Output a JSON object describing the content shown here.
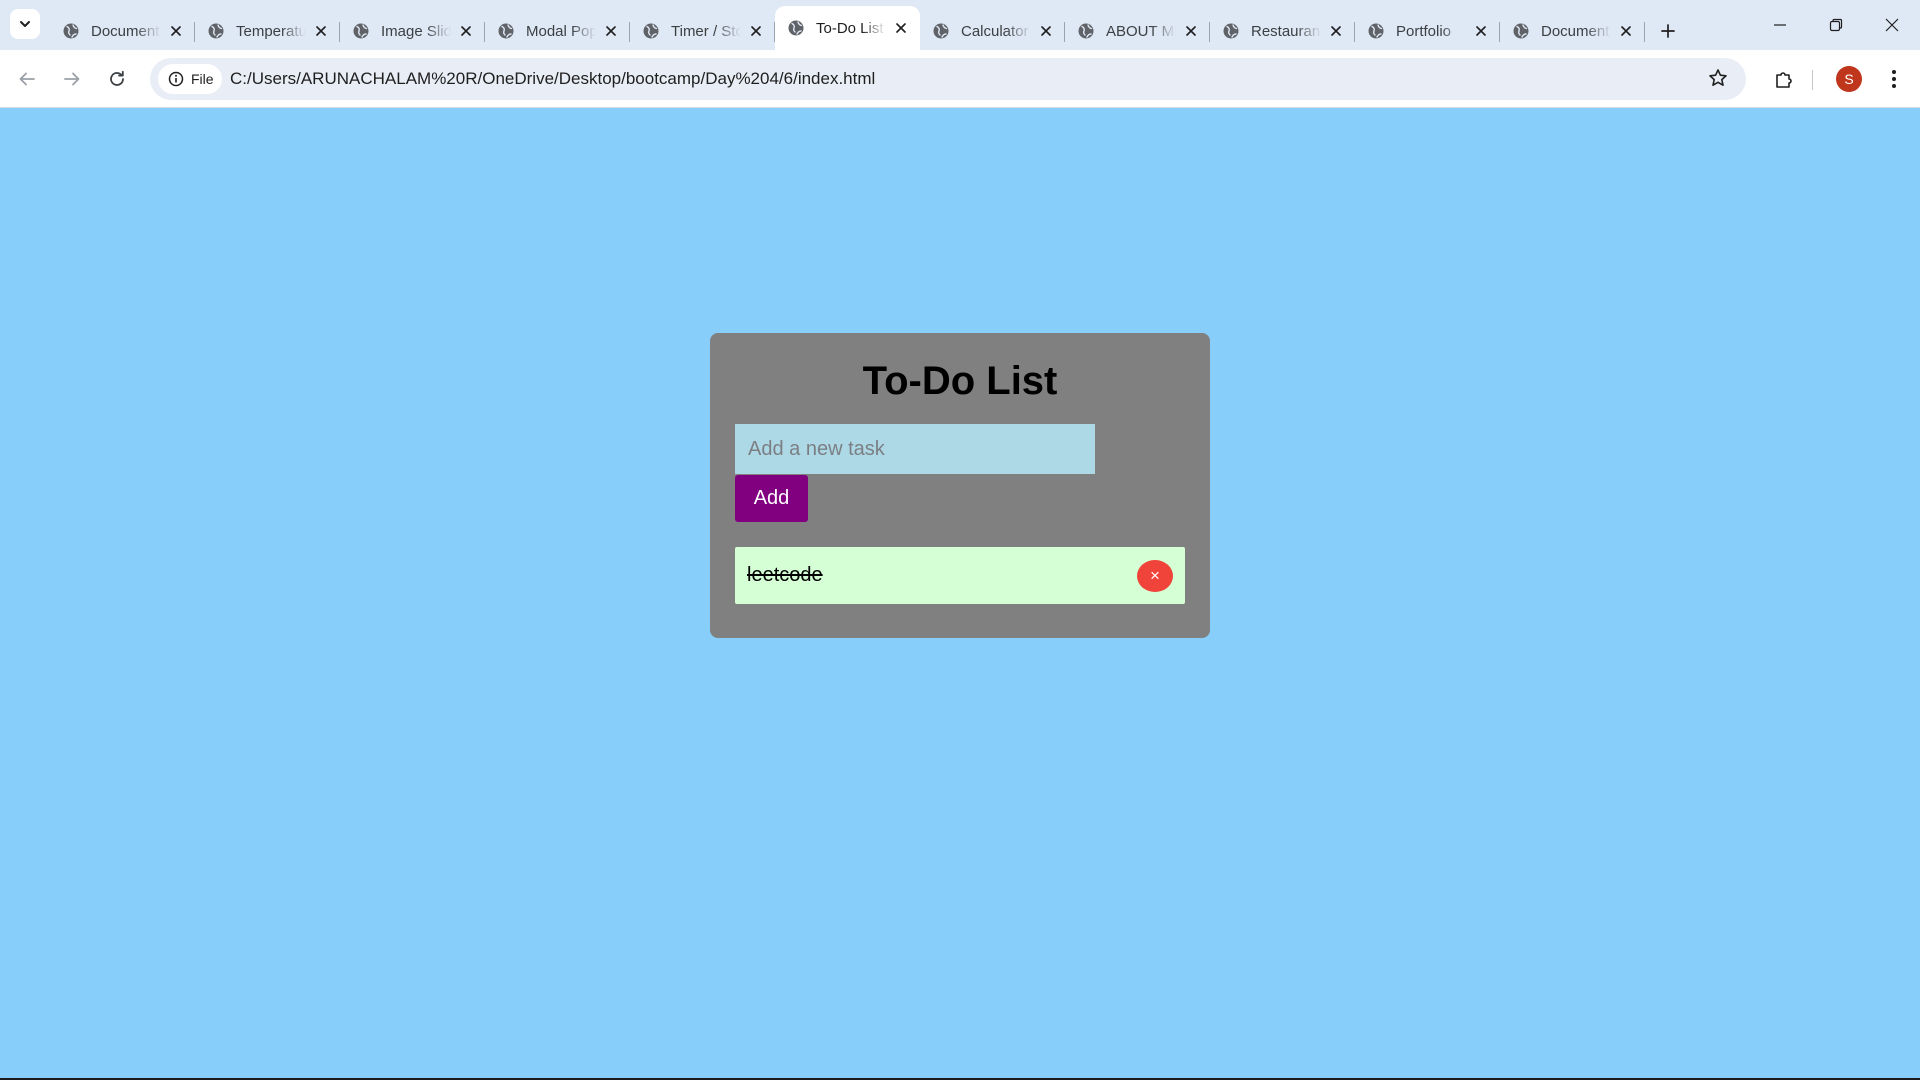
{
  "browser": {
    "tabs": [
      {
        "title": "Document",
        "active": false
      },
      {
        "title": "Temperature",
        "active": false
      },
      {
        "title": "Image Slider",
        "active": false
      },
      {
        "title": "Modal Popup",
        "active": false
      },
      {
        "title": "Timer / Stopwatch",
        "active": false
      },
      {
        "title": "To-Do List",
        "active": true
      },
      {
        "title": "Calculator",
        "active": false
      },
      {
        "title": "ABOUT ME",
        "active": false
      },
      {
        "title": "Restaurant",
        "active": false
      },
      {
        "title": "Portfolio",
        "active": false
      },
      {
        "title": "Document",
        "active": false
      }
    ],
    "site_chip_label": "File",
    "url": "C:/Users/ARUNACHALAM%20R/OneDrive/Desktop/bootcamp/Day%204/6/index.html",
    "profile_initial": "S",
    "icons": {
      "tab_search": "chevron-down-icon",
      "favicon": "globe-icon",
      "close": "close-icon",
      "new_tab": "plus-icon",
      "back": "arrow-left-icon",
      "forward": "arrow-right-icon",
      "reload": "reload-icon",
      "site_info": "info-icon",
      "bookmark": "star-icon",
      "extensions": "puzzle-icon",
      "menu": "kebab-menu-icon"
    }
  },
  "app": {
    "title": "To-Do List",
    "input_placeholder": "Add a new task",
    "input_value": "",
    "add_label": "Add",
    "tasks": [
      {
        "text": "leetcode",
        "completed": true,
        "delete_label": "×"
      }
    ]
  },
  "colors": {
    "page_background": "#87cefa",
    "card_background": "#808080",
    "input_background": "#add8e6",
    "add_button": "#800080",
    "task_background": "#d5ffd5",
    "delete_button": "#f0443a",
    "avatar": "#c0361c"
  }
}
